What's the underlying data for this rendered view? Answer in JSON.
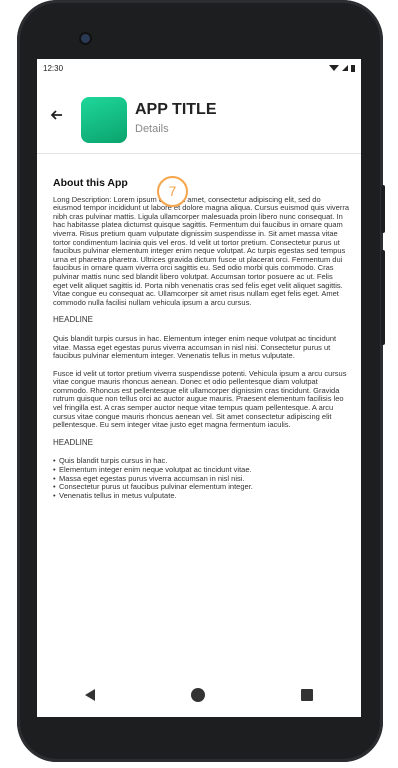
{
  "status": {
    "time": "12:30"
  },
  "header": {
    "app_title": "APP TITLE",
    "app_sub": "Details"
  },
  "badge": {
    "number": "7"
  },
  "content": {
    "about_title": "About this App",
    "long_description": "Long Description: Lorem ipsum dolor sit amet, consectetur adipiscing elit, sed do eiusmod tempor incididunt ut labore et dolore magna aliqua. Cursus euismod quis viverra nibh cras pulvinar mattis. Ligula ullamcorper malesuada proin libero nunc consequat. In hac habitasse platea dictumst quisque sagittis. Fermentum dui faucibus in ornare quam viverra. Risus pretium quam vulputate dignissim suspendisse in. Sit amet massa vitae tortor condimentum lacinia quis vel eros. Id velit ut tortor pretium. Consectetur purus ut faucibus pulvinar elementum integer enim neque volutpat. Ac turpis egestas sed tempus urna et pharetra pharetra. Ultrices gravida dictum fusce ut placerat orci. Fermentum dui faucibus in ornare quam viverra orci sagittis eu. Sed odio morbi quis commodo. Cras pulvinar mattis nunc sed blandit libero volutpat. Accumsan tortor posuere ac ut. Felis eget velit aliquet sagittis id. Porta nibh venenatis cras sed felis eget velit aliquet sagittis. Vitae congue eu consequat ac. Ullamcorper sit amet risus nullam eget felis eget. Amet commodo nulla facilisi nullam vehicula ipsum a arcu cursus.",
    "headline1": "HEADLINE",
    "para1": "Quis blandit turpis cursus in hac. Elementum integer enim neque volutpat ac tincidunt vitae. Massa eget egestas purus viverra accumsan in nisl nisi. Consectetur purus ut faucibus pulvinar elementum integer. Venenatis tellus in metus vulputate.",
    "para2": "Fusce id velit ut tortor pretium viverra suspendisse potenti. Vehicula ipsum a arcu cursus vitae congue mauris rhoncus aenean. Donec et odio pellentesque diam volutpat commodo. Rhoncus est pellentesque elit ullamcorper dignissim cras tincidunt. Gravida rutrum quisque non tellus orci ac auctor augue mauris. Praesent elementum facilisis leo vel fringilla est. A cras semper auctor neque vitae tempus quam pellentesque. A arcu cursus vitae congue mauris rhoncus aenean vel. Sit amet consectetur adipiscing elit pellentesque. Eu sem integer vitae justo eget magna fermentum iaculis.",
    "headline2": "HEADLINE",
    "bullets": [
      "Quis blandit turpis cursus in hac.",
      "Elementum integer enim neque volutpat ac tincidunt vitae.",
      "Massa eget egestas purus viverra accumsan in nisl nisi.",
      "Consectetur purus ut faucibus pulvinar elementum integer.",
      "Venenatis tellus in metus vulputate."
    ]
  },
  "colors": {
    "accent_green": "#11c085",
    "badge_orange": "#f5a54a"
  }
}
